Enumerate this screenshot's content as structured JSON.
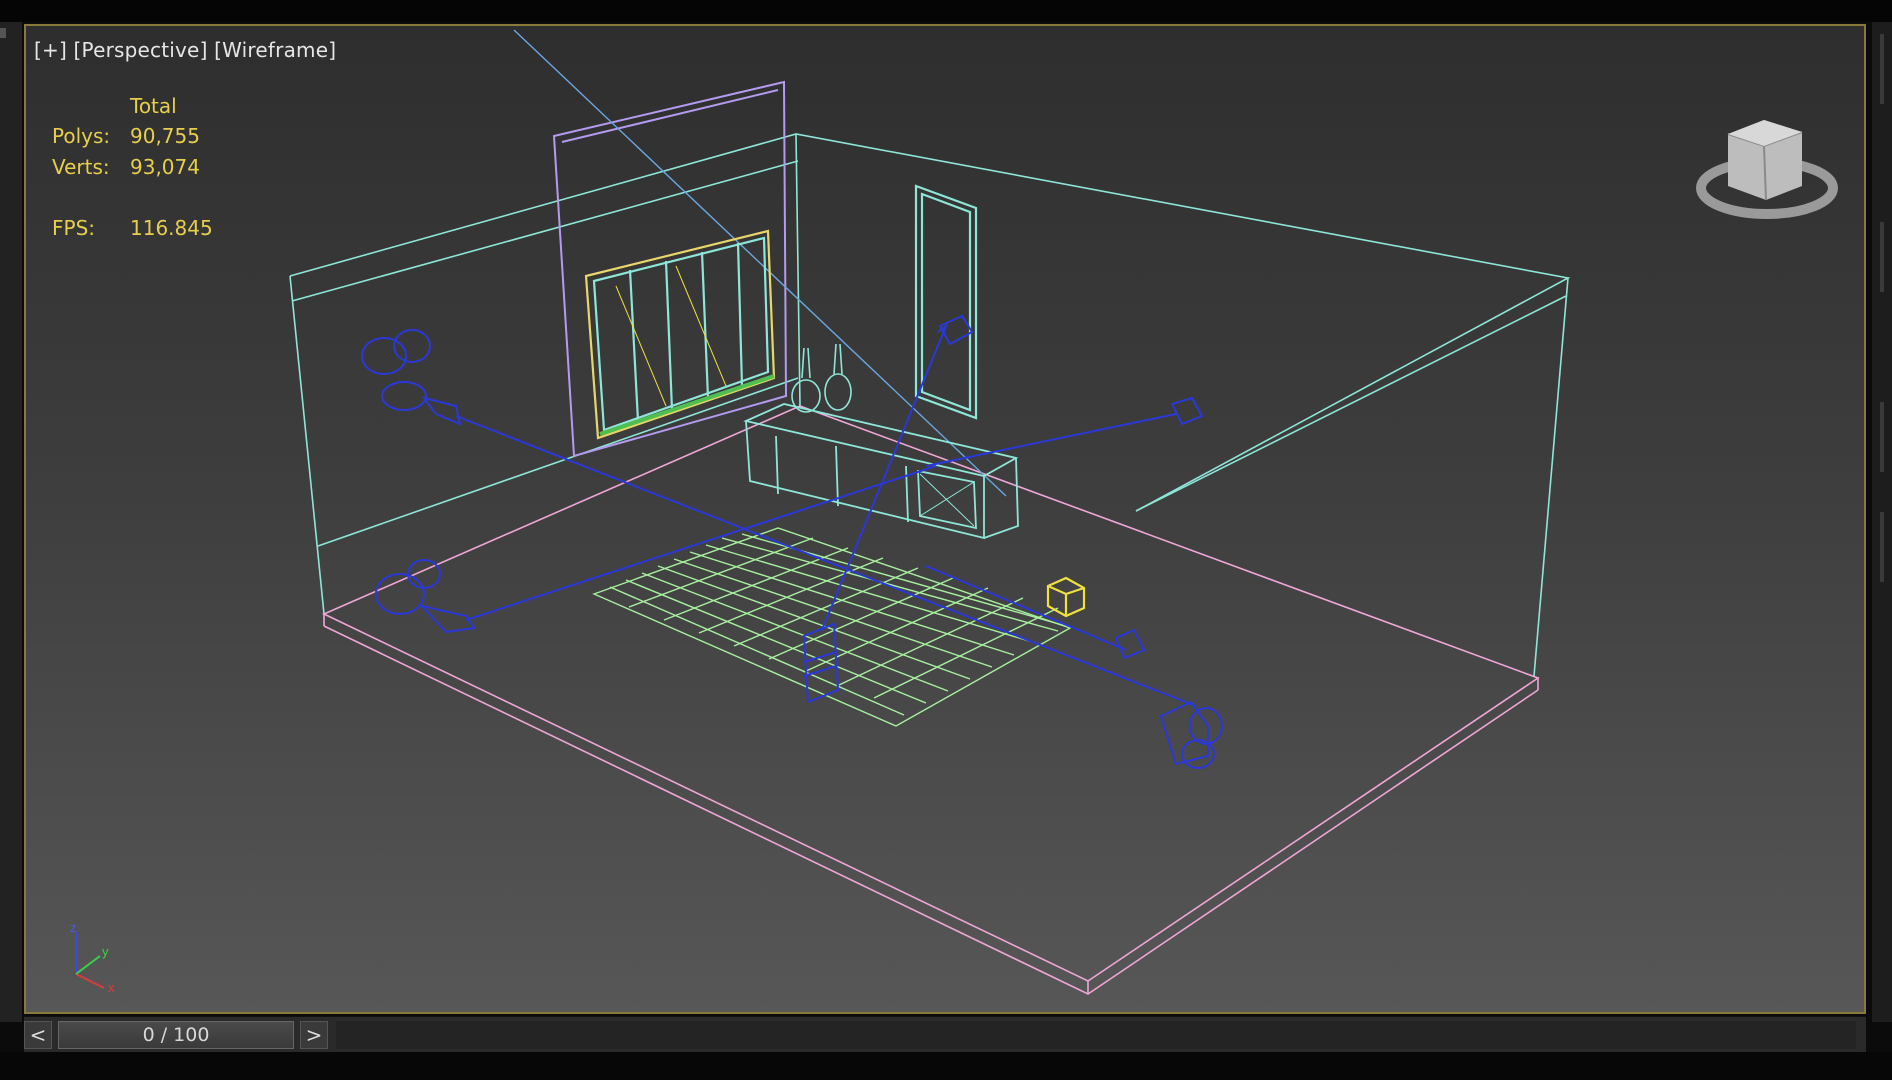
{
  "viewport": {
    "labels": {
      "plus": "[+]",
      "view": "[Perspective]",
      "shading": "[Wireframe]"
    },
    "stats": {
      "header": "Total",
      "polys_label": "Polys:",
      "polys_value": "90,755",
      "verts_label": "Verts:",
      "verts_value": "93,074",
      "fps_label": "FPS:",
      "fps_value": "116.845"
    },
    "axis_labels": {
      "z": "z",
      "y": "y",
      "x": "x"
    },
    "colors": {
      "room": "#8ee6d8",
      "floor": "#f0a6d8",
      "door": "#b49bf0",
      "window": "#e9d66a",
      "lights": "#2b38d8",
      "rug": "#a8f0a0",
      "selected_box": "#f0e040",
      "border": "#8a7a3a"
    },
    "icons": [
      "viewcube-icon",
      "axis-tripod-icon"
    ]
  },
  "timeline": {
    "prev": "<",
    "next": ">",
    "frame": "0 / 100"
  }
}
